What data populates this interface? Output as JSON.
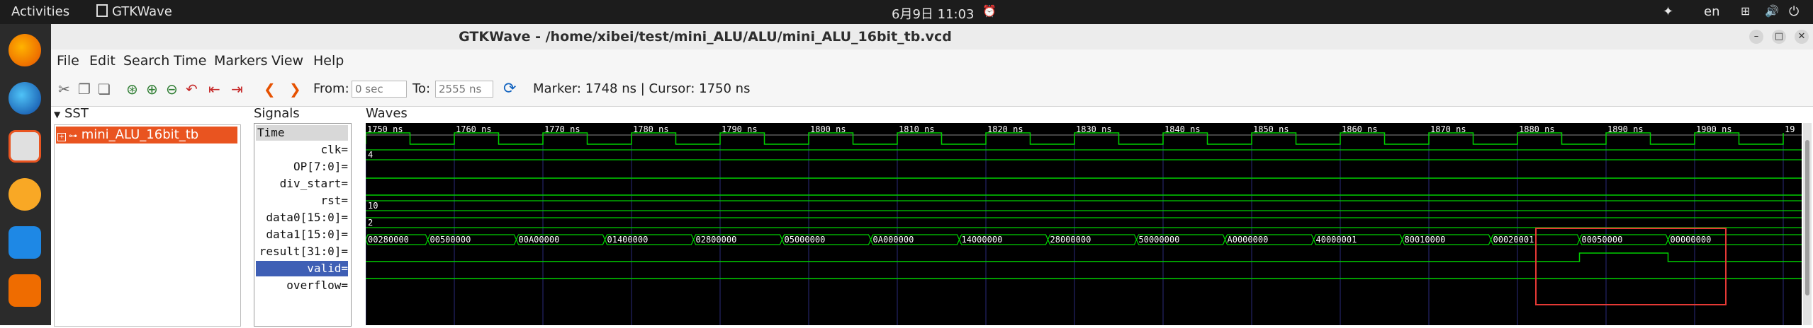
{
  "topbar": {
    "activities": "Activities",
    "app_name": "GTKWave",
    "datetime": "6月9日  11:03",
    "lang": "en"
  },
  "window": {
    "title": "GTKWave - /home/xibei/test/mini_ALU/ALU/mini_ALU_16bit_tb.vcd"
  },
  "menu": [
    "File",
    "Edit",
    "Search",
    "Time",
    "Markers",
    "View",
    "Help"
  ],
  "toolbar": {
    "from_label": "From:",
    "from_value": "0 sec",
    "to_label": "To:",
    "to_value": "2555 ns",
    "marker_cursor": "Marker: 1748 ns  |  Cursor: 1750 ns"
  },
  "panes": {
    "sst_label": "SST",
    "signals_label": "Signals",
    "waves_label": "Waves",
    "tree_item": "mini_ALU_16bit_tb"
  },
  "signals": [
    {
      "label": "Time"
    },
    {
      "label": "clk="
    },
    {
      "label": "OP[7:0]="
    },
    {
      "label": "div_start="
    },
    {
      "label": "rst="
    },
    {
      "label": "data0[15:0]="
    },
    {
      "label": "data1[15:0]="
    },
    {
      "label": "result[31:0]="
    },
    {
      "label": "valid="
    },
    {
      "label": "overflow="
    }
  ],
  "timeline": {
    "ticks": [
      {
        "t": 1750,
        "label": "1750 ns"
      },
      {
        "t": 1760,
        "label": "1760 ns"
      },
      {
        "t": 1770,
        "label": "1770 ns"
      },
      {
        "t": 1780,
        "label": "1780 ns"
      },
      {
        "t": 1790,
        "label": "1790 ns"
      },
      {
        "t": 1800,
        "label": "1800 ns"
      },
      {
        "t": 1810,
        "label": "1810 ns"
      },
      {
        "t": 1820,
        "label": "1820 ns"
      },
      {
        "t": 1830,
        "label": "1830 ns"
      },
      {
        "t": 1840,
        "label": "1840 ns"
      },
      {
        "t": 1850,
        "label": "1850 ns"
      },
      {
        "t": 1860,
        "label": "1860 ns"
      },
      {
        "t": 1870,
        "label": "1870 ns"
      },
      {
        "t": 1880,
        "label": "1880 ns"
      },
      {
        "t": 1890,
        "label": "1890 ns"
      },
      {
        "t": 1900,
        "label": "1900 ns"
      },
      {
        "t": 1910,
        "label": "19"
      }
    ],
    "clk_period_ns": 5,
    "const_values": {
      "OP": "4",
      "data0": "10",
      "data1": "2"
    },
    "result_values": [
      {
        "t": 1750,
        "v": "00280000"
      },
      {
        "t": 1757,
        "v": "00500000"
      },
      {
        "t": 1767,
        "v": "00A00000"
      },
      {
        "t": 1777,
        "v": "01400000"
      },
      {
        "t": 1787,
        "v": "02800000"
      },
      {
        "t": 1797,
        "v": "05000000"
      },
      {
        "t": 1807,
        "v": "0A000000"
      },
      {
        "t": 1817,
        "v": "14000000"
      },
      {
        "t": 1827,
        "v": "28000000"
      },
      {
        "t": 1837,
        "v": "50000000"
      },
      {
        "t": 1847,
        "v": "A0000000"
      },
      {
        "t": 1857,
        "v": "40000001"
      },
      {
        "t": 1867,
        "v": "80010000"
      },
      {
        "t": 1877,
        "v": "00020001"
      },
      {
        "t": 1887,
        "v": "00050000"
      },
      {
        "t": 1897,
        "v": "00000000"
      }
    ],
    "valid_high": [
      1887,
      1897
    ]
  },
  "colors": {
    "wave_green": "#00d000",
    "grid": "#2a2a7a",
    "accent": "#e95420",
    "highlight": "#e53935"
  }
}
